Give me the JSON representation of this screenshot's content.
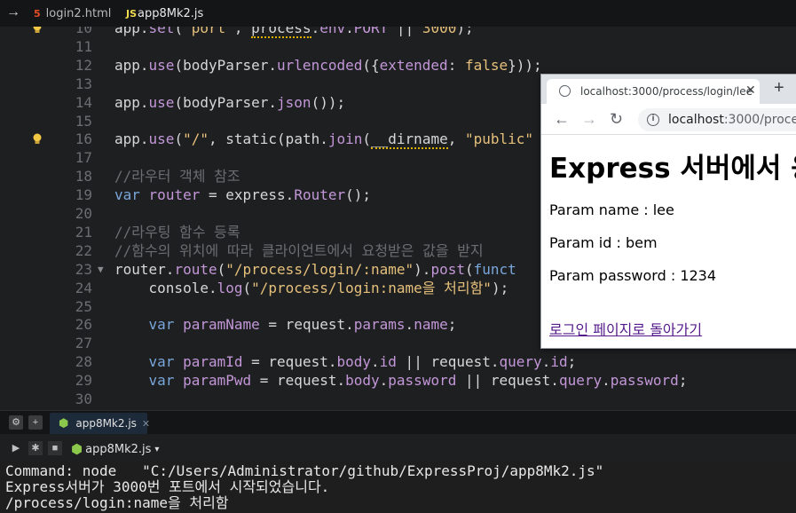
{
  "editor_tabs": [
    {
      "icon": "5",
      "label": "login2.html"
    },
    {
      "icon": "JS",
      "label": "app8Mk2.js"
    }
  ],
  "code_lines": [
    {
      "n": "10",
      "html": "<span class=\"w\">app.</span><span class=\"f\">set</span><span class=\"w\">(</span><span class=\"s\">'port'</span><span class=\"w\">, </span><span class=\"und\">process</span><span class=\"w\">.</span><span class=\"p\">env</span><span class=\"w\">.</span><span class=\"p\">PORT</span><span class=\"w\"> || </span><span class=\"s\">3000</span><span class=\"w\">);</span>"
    },
    {
      "n": "11",
      "html": ""
    },
    {
      "n": "12",
      "html": "<span class=\"w\">app.</span><span class=\"f\">use</span><span class=\"w\">(bodyParser.</span><span class=\"f\">urlencoded</span><span class=\"w\">({</span><span class=\"p\">extended</span><span class=\"w\">: </span><span class=\"s\">false</span><span class=\"w\">}));</span>"
    },
    {
      "n": "13",
      "html": ""
    },
    {
      "n": "14",
      "html": "<span class=\"w\">app.</span><span class=\"f\">use</span><span class=\"w\">(bodyParser.</span><span class=\"f\">json</span><span class=\"w\">());</span>"
    },
    {
      "n": "15",
      "html": ""
    },
    {
      "n": "16",
      "html": "<span class=\"w\">app.</span><span class=\"f\">use</span><span class=\"w\">(</span><span class=\"s\">\"/\"</span><span class=\"w\">, static(path.</span><span class=\"f\">join</span><span class=\"w\">(</span><span class=\"und\">__dirname</span><span class=\"w\">, </span><span class=\"s\">\"public\"</span>"
    },
    {
      "n": "17",
      "html": ""
    },
    {
      "n": "18",
      "html": "<span class=\"c\">//라우터 객체 참조</span>"
    },
    {
      "n": "19",
      "html": "<span class=\"k\">var</span><span class=\"w\"> </span><span class=\"p\">router</span><span class=\"w\"> = express.</span><span class=\"f\">Router</span><span class=\"w\">();</span>"
    },
    {
      "n": "20",
      "html": ""
    },
    {
      "n": "21",
      "html": "<span class=\"c\">//라우팅 함수 등록</span>"
    },
    {
      "n": "22",
      "html": "<span class=\"c\">//함수의 위치에 따라 클라이언트에서 요청받은 값을 받지</span>"
    },
    {
      "n": "23",
      "html": "<span class=\"w\">router.</span><span class=\"f\">route</span><span class=\"w\">(</span><span class=\"s\">\"/process/login/:name\"</span><span class=\"w\">).</span><span class=\"f\">post</span><span class=\"w\">(</span><span class=\"k\">funct</span>"
    },
    {
      "n": "24",
      "html": "<span class=\"w\">    console.</span><span class=\"f\">log</span><span class=\"w\">(</span><span class=\"s\">\"/process/login:name을 처리함\"</span><span class=\"w\">);</span>"
    },
    {
      "n": "25",
      "html": ""
    },
    {
      "n": "26",
      "html": "<span class=\"w\">    </span><span class=\"k\">var</span><span class=\"w\"> </span><span class=\"p\">paramName</span><span class=\"w\"> = request.</span><span class=\"p\">params</span><span class=\"w\">.</span><span class=\"p\">name</span><span class=\"w\">;</span>"
    },
    {
      "n": "27",
      "html": ""
    },
    {
      "n": "28",
      "html": "<span class=\"w\">    </span><span class=\"k\">var</span><span class=\"w\"> </span><span class=\"p\">paramId</span><span class=\"w\"> = request.</span><span class=\"p\">body</span><span class=\"w\">.</span><span class=\"p\">id</span><span class=\"w\"> || request.</span><span class=\"p\">query</span><span class=\"w\">.</span><span class=\"p\">id</span><span class=\"w\">;</span>"
    },
    {
      "n": "29",
      "html": "<span class=\"w\">    </span><span class=\"k\">var</span><span class=\"w\"> </span><span class=\"p\">paramPwd</span><span class=\"w\"> = request.</span><span class=\"p\">body</span><span class=\"w\">.</span><span class=\"p\">password</span><span class=\"w\"> || request.</span><span class=\"p\">query</span><span class=\"w\">.</span><span class=\"p\">password</span><span class=\"w\">;</span>"
    },
    {
      "n": "30",
      "html": ""
    }
  ],
  "panel": {
    "tab_label": "app8Mk2.js",
    "run_file": "app8Mk2.js"
  },
  "console_lines": [
    "Command: node   \"C:/Users/Administrator/github/ExpressProj/app8Mk2.js\"",
    "Express서버가 3000번 포트에서 시작되었습니다.",
    "/process/login:name을 처리함"
  ],
  "browser": {
    "tab_title": "localhost:3000/process/login/lee",
    "url_host": "localhost",
    "url_rest": ":3000/process/",
    "heading": "Express 서버에서 응",
    "param_name": "Param name : lee",
    "param_id": "Param id : bem",
    "param_password": "Param password : 1234",
    "back_link": "로그인 페이지로 돌아가기"
  }
}
